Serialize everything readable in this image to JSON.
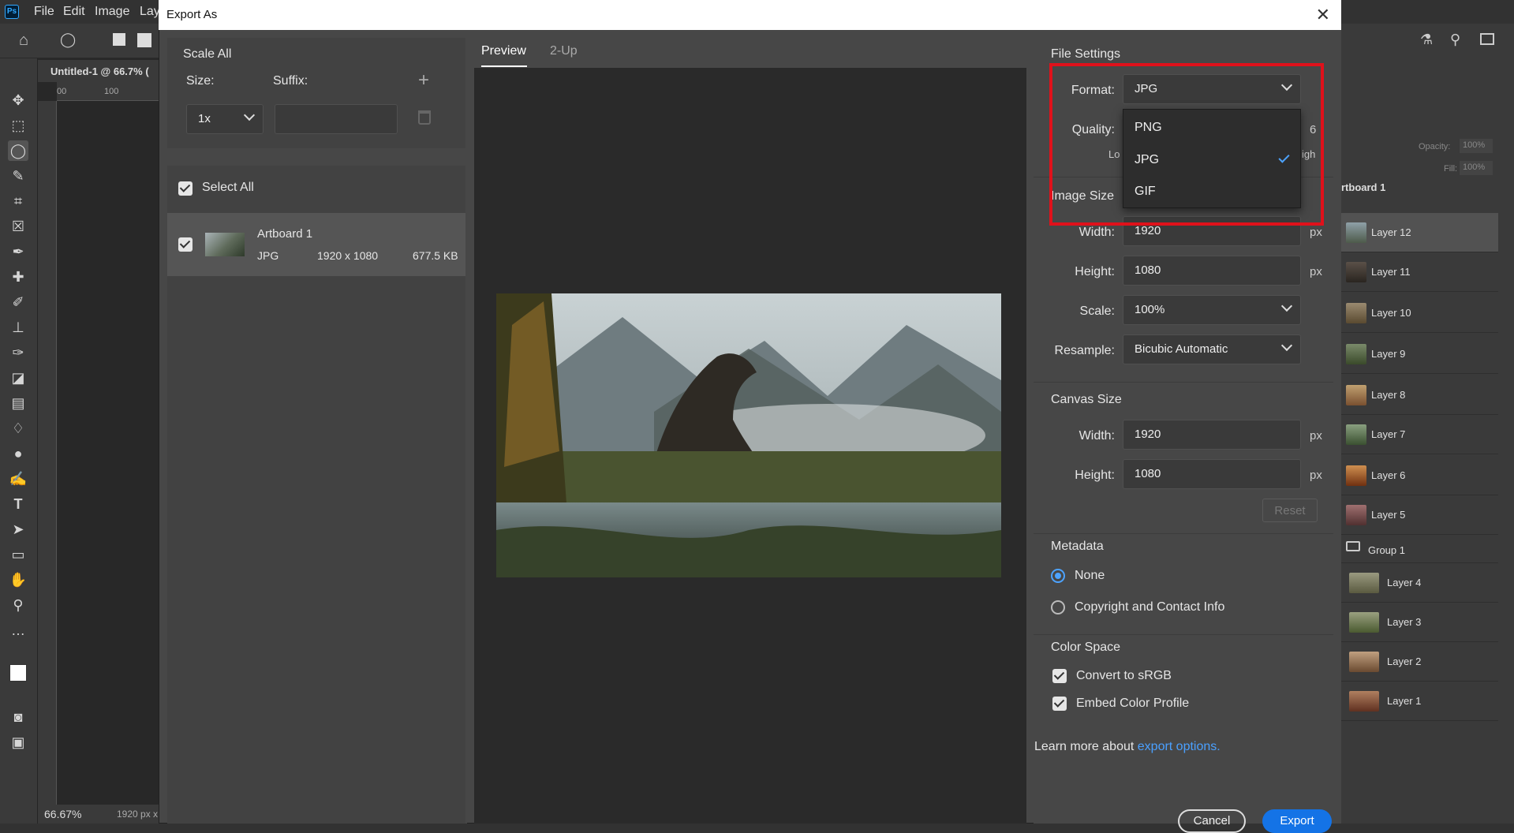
{
  "app": {
    "menu": [
      "File",
      "Edit",
      "Image",
      "Lay"
    ],
    "doc_tab": "Untitled-1 @ 66.7% (",
    "zoom": "66.67%",
    "doc_size": "1920 px x",
    "ruler_marks": [
      "00",
      "100"
    ]
  },
  "dialog": {
    "title": "Export As",
    "close_label": "✕",
    "scale_all": {
      "heading": "Scale All",
      "size_label": "Size:",
      "suffix_label": "Suffix:",
      "size_value": "1x",
      "suffix_value": "",
      "add_label": "+"
    },
    "assets": {
      "select_all": "Select All",
      "items": [
        {
          "name": "Artboard 1",
          "format": "JPG",
          "dims": "1920 x 1080",
          "size": "677.5 KB"
        }
      ]
    },
    "tabs": [
      "Preview",
      "2-Up"
    ],
    "file_settings": {
      "heading": "File Settings",
      "format_label": "Format:",
      "format_value": "JPG",
      "quality_label": "Quality:",
      "quality_value": "6",
      "quality_low": "Lo",
      "quality_high": "igh",
      "options": [
        "PNG",
        "JPG",
        "GIF"
      ],
      "selected_option": "JPG"
    },
    "image_size": {
      "heading": "Image Size",
      "width_label": "Width:",
      "width_value": "1920",
      "height_label": "Height:",
      "height_value": "1080",
      "scale_label": "Scale:",
      "scale_value": "100%",
      "resample_label": "Resample:",
      "resample_value": "Bicubic Automatic",
      "unit": "px"
    },
    "canvas_size": {
      "heading": "Canvas Size",
      "width_label": "Width:",
      "width_value": "1920",
      "height_label": "Height:",
      "height_value": "1080",
      "reset": "Reset",
      "unit": "px"
    },
    "metadata": {
      "heading": "Metadata",
      "options": [
        "None",
        "Copyright and Contact Info"
      ],
      "selected": "None"
    },
    "color_space": {
      "heading": "Color Space",
      "convert": "Convert to sRGB",
      "embed": "Embed Color Profile"
    },
    "learn_more": "Learn more about",
    "learn_link": "export options.",
    "cancel": "Cancel",
    "export": "Export"
  },
  "layers": {
    "opacity_label": "Opacity:",
    "opacity_value": "100%",
    "fill_label": "Fill:",
    "fill_value": "100%",
    "artboard": "rtboard 1",
    "items": [
      "Layer 12",
      "Layer 11",
      "Layer 10",
      "Layer 9",
      "Layer 8",
      "Layer 7",
      "Layer 6",
      "Layer 5",
      "Group 1",
      "Layer 4",
      "Layer 3",
      "Layer 2",
      "Layer 1"
    ]
  },
  "colors": {
    "accent": "#1473e6",
    "highlight": "#e0111b",
    "link": "#4aa0ff"
  }
}
